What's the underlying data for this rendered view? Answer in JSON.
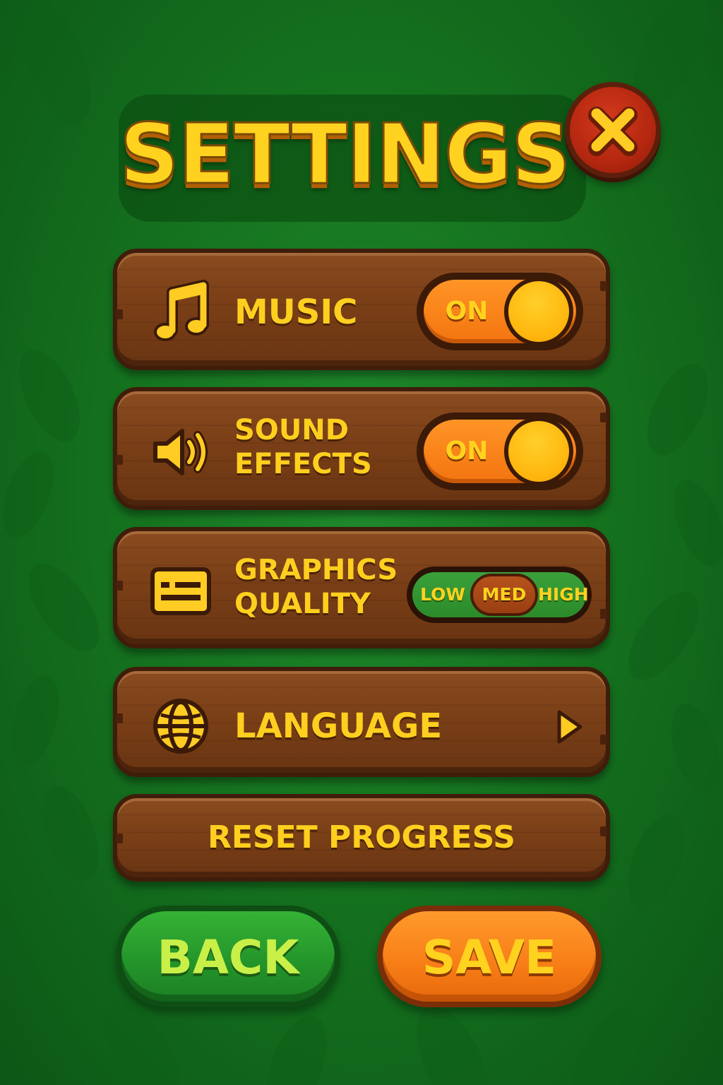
{
  "screen": {
    "title": "SETTINGS",
    "close_icon": "close-icon"
  },
  "settings": {
    "music": {
      "icon": "music-note-icon",
      "label": "MUSIC",
      "state": "ON"
    },
    "sound_effects": {
      "icon": "speaker-icon",
      "label_line1": "SOUND",
      "label_line2": "EFFECTS",
      "state": "ON"
    },
    "graphics_quality": {
      "icon": "graphics-card-icon",
      "label_line1": "GRAPHICS",
      "label_line2": "QUALITY",
      "options": [
        "LOW",
        "MED",
        "HIGH"
      ],
      "selected": "MED"
    },
    "language": {
      "icon": "globe-icon",
      "label": "LANGUAGE",
      "arrow_icon": "arrow-right-icon"
    },
    "reset": {
      "label": "RESET PROGRESS"
    }
  },
  "actions": {
    "back_label": "BACK",
    "save_label": "SAVE"
  },
  "colors": {
    "background": "#15731f",
    "plank": "#7a3f17",
    "text_gold": "#ffcf1f",
    "toggle_on": "#f77d16",
    "close_red": "#b42710",
    "back_green": "#23932a",
    "save_orange": "#f77d16"
  }
}
